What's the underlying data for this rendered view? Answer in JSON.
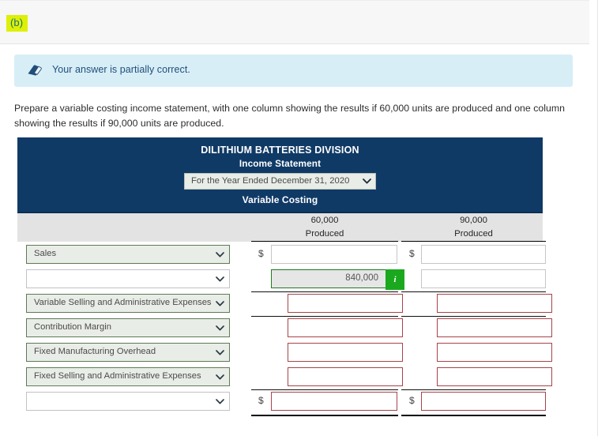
{
  "part": {
    "label": "(b)"
  },
  "banner": {
    "icon": "eraser-icon",
    "message": "Your answer is partially correct.",
    "bg_color": "#d7eef7",
    "text_color": "#1f4e79"
  },
  "instruction": {
    "text": "Prepare a variable costing income statement, with one column showing the results if 60,000 units are produced and one column showing the results if 90,000 units are produced."
  },
  "statement": {
    "company": "DILITHIUM BATTERIES DIVISION",
    "title": "Income Statement",
    "period_selected": "For the Year Ended December 31, 2020",
    "costing_method": "Variable Costing",
    "header_bg": "#103a66",
    "columns": [
      {
        "amount": "60,000",
        "unit": "Produced"
      },
      {
        "amount": "90,000",
        "unit": "Produced"
      }
    ],
    "currency_symbol": "$",
    "rows": [
      {
        "account": "Sales",
        "account_filled": true,
        "col1": {
          "value": "",
          "dollar": true,
          "state": "empty",
          "info": false
        },
        "col2": {
          "value": "",
          "dollar": true,
          "state": "empty",
          "info": false
        }
      },
      {
        "account": "",
        "account_filled": false,
        "col1": {
          "value": "840,000",
          "dollar": false,
          "state": "correct",
          "info": true,
          "info_label": "i"
        },
        "col2": {
          "value": "",
          "dollar": false,
          "state": "empty",
          "info": false
        }
      },
      {
        "account": "Variable Selling and Administrative Expenses",
        "account_filled": true,
        "col1": {
          "value": "",
          "dollar": false,
          "state": "incorrect",
          "info": false
        },
        "col2": {
          "value": "",
          "dollar": false,
          "state": "incorrect",
          "info": false
        }
      },
      {
        "account": "Contribution Margin",
        "account_filled": true,
        "col1": {
          "value": "",
          "dollar": false,
          "state": "incorrect",
          "info": false
        },
        "col2": {
          "value": "",
          "dollar": false,
          "state": "incorrect",
          "info": false
        }
      },
      {
        "account": "Fixed Manufacturing Overhead",
        "account_filled": true,
        "col1": {
          "value": "",
          "dollar": false,
          "state": "incorrect",
          "info": false
        },
        "col2": {
          "value": "",
          "dollar": false,
          "state": "incorrect",
          "info": false
        }
      },
      {
        "account": "Fixed Selling and Administrative Expenses",
        "account_filled": true,
        "col1": {
          "value": "",
          "dollar": false,
          "state": "incorrect",
          "info": false
        },
        "col2": {
          "value": "",
          "dollar": false,
          "state": "incorrect",
          "info": false
        }
      },
      {
        "account": "",
        "account_filled": false,
        "col1": {
          "value": "",
          "dollar": true,
          "state": "incorrect",
          "info": false
        },
        "col2": {
          "value": "",
          "dollar": true,
          "state": "incorrect",
          "info": false
        }
      }
    ]
  },
  "colors": {
    "highlight": "#ddf005",
    "highlight_text": "#17707e",
    "navy": "#103a66",
    "green_badge": "#1aa81f",
    "error_border": "#a6444a",
    "ok_border": "#1f7a22"
  }
}
